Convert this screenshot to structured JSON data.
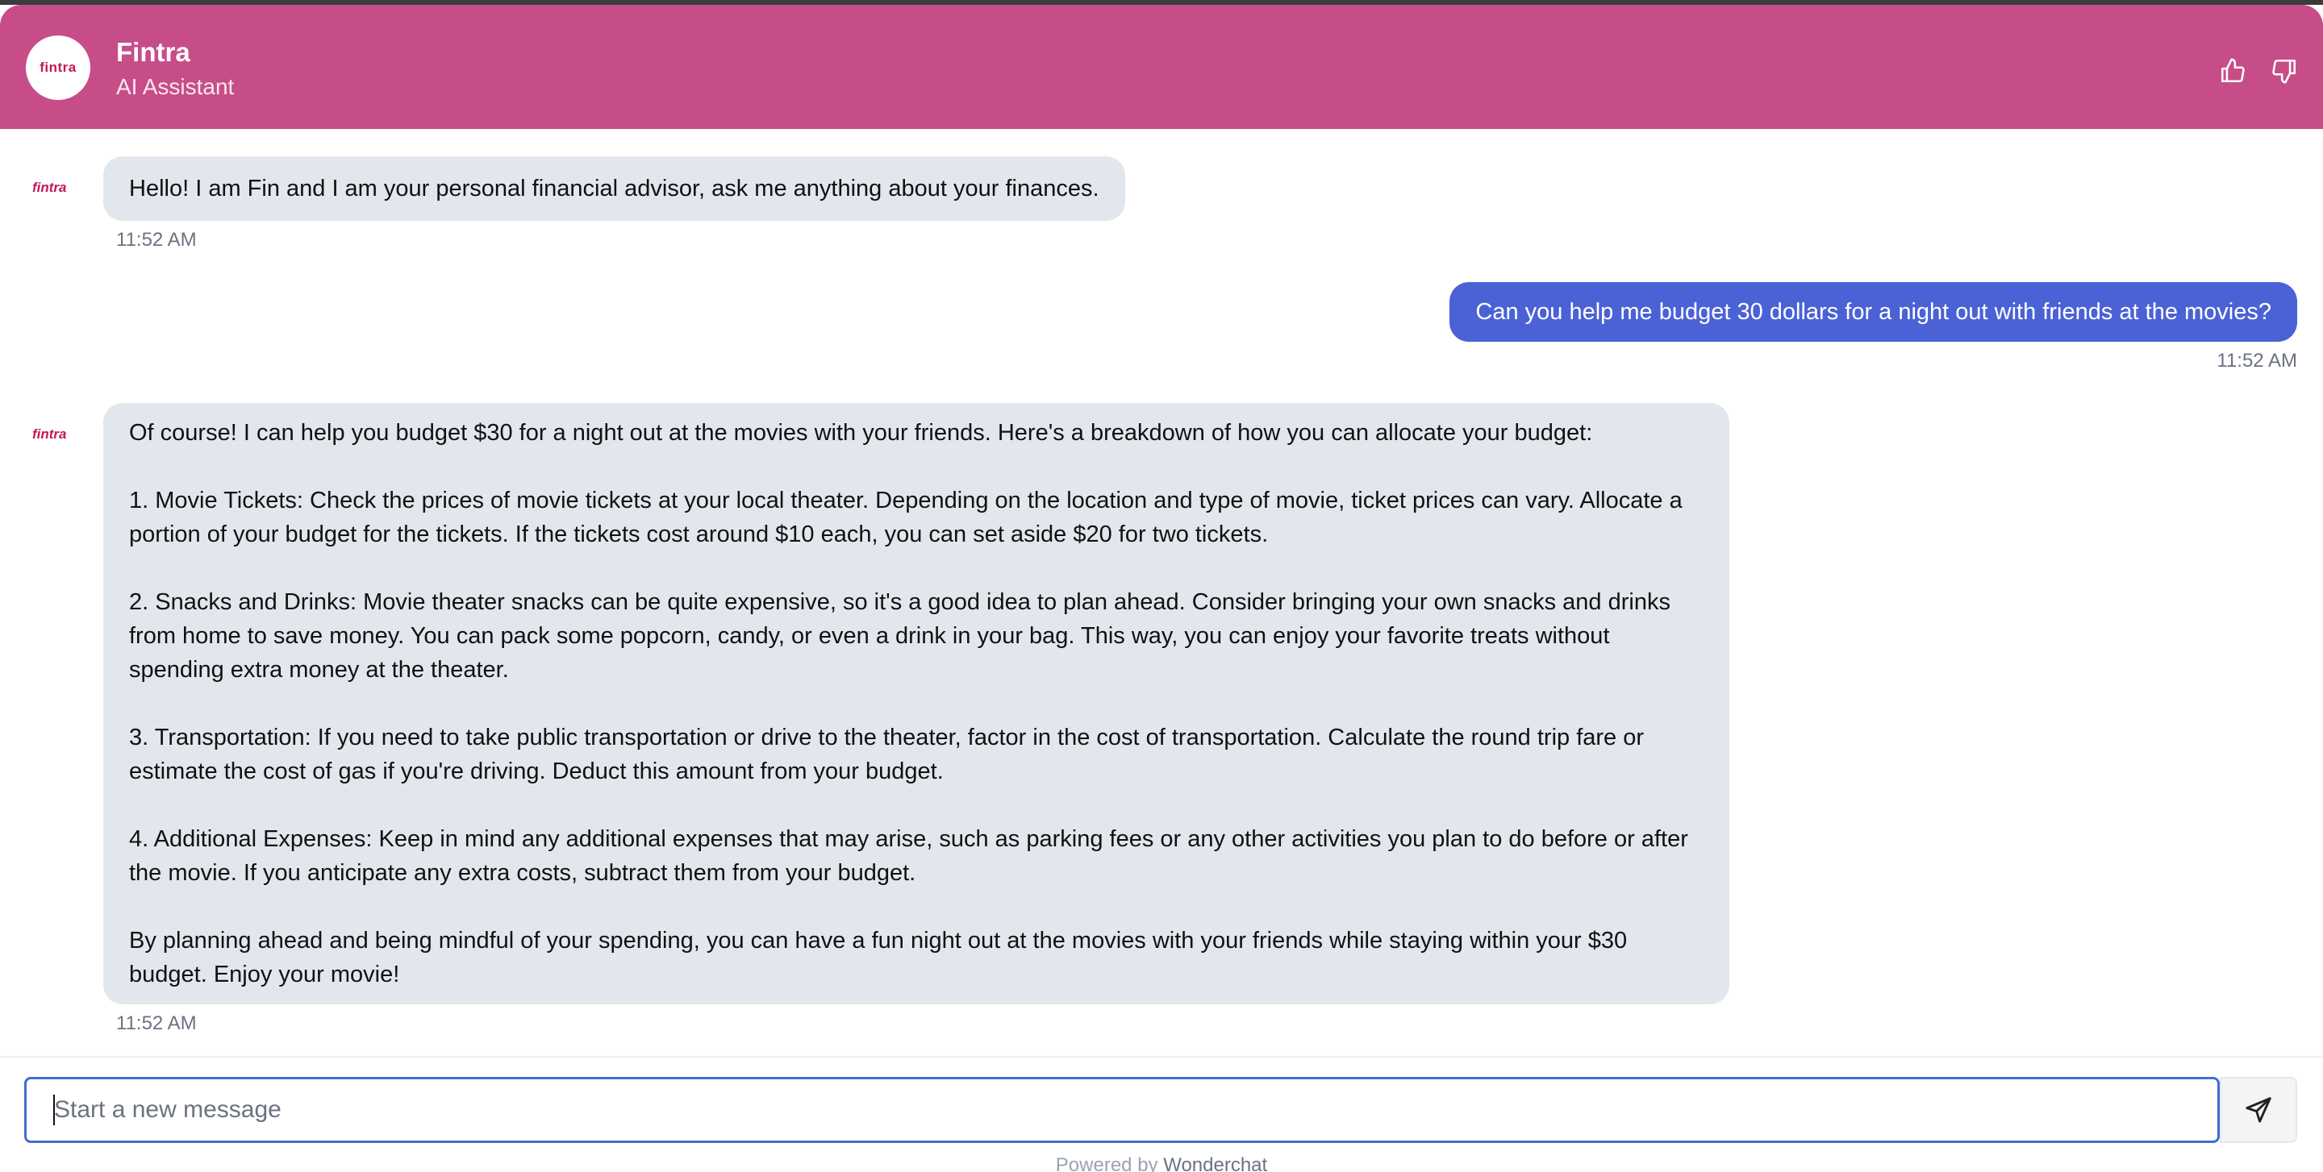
{
  "header": {
    "logo_text": "fintra",
    "title": "Fintra",
    "subtitle": "AI Assistant",
    "background": "#c74d88"
  },
  "messages": [
    {
      "role": "bot",
      "avatar": "fintra",
      "paragraphs": [
        "Hello! I am Fin and I am your personal financial advisor, ask me anything about your finances."
      ],
      "time": "11:52 AM"
    },
    {
      "role": "user",
      "paragraphs": [
        "Can you help me budget 30 dollars for a night out with friends at the movies?"
      ],
      "time": "11:52 AM"
    },
    {
      "role": "bot",
      "avatar": "fintra",
      "paragraphs": [
        "Of course! I can help you budget $30 for a night out at the movies with your friends. Here's a breakdown of how you can allocate your budget:",
        "1. Movie Tickets: Check the prices of movie tickets at your local theater. Depending on the location and type of movie, ticket prices can vary. Allocate a portion of your budget for the tickets. If the tickets cost around $10 each, you can set aside $20 for two tickets.",
        "2. Snacks and Drinks: Movie theater snacks can be quite expensive, so it's a good idea to plan ahead. Consider bringing your own snacks and drinks from home to save money. You can pack some popcorn, candy, or even a drink in your bag. This way, you can enjoy your favorite treats without spending extra money at the theater.",
        "3. Transportation: If you need to take public transportation or drive to the theater, factor in the cost of transportation. Calculate the round trip fare or estimate the cost of gas if you're driving. Deduct this amount from your budget.",
        "4. Additional Expenses: Keep in mind any additional expenses that may arise, such as parking fees or any other activities you plan to do before or after the movie. If you anticipate any extra costs, subtract them from your budget.",
        "By planning ahead and being mindful of your spending, you can have a fun night out at the movies with your friends while staying within your $30 budget. Enjoy your movie!"
      ],
      "time": "11:52 AM"
    }
  ],
  "composer": {
    "placeholder": "Start a new message"
  },
  "footer": {
    "powered_by": "Powered by",
    "brand": "Wonderchat"
  },
  "colors": {
    "accent": "#c74d88",
    "user_bubble": "#4b62d6",
    "bot_bubble": "#e2e7ee",
    "input_border": "#3f6fd1"
  }
}
